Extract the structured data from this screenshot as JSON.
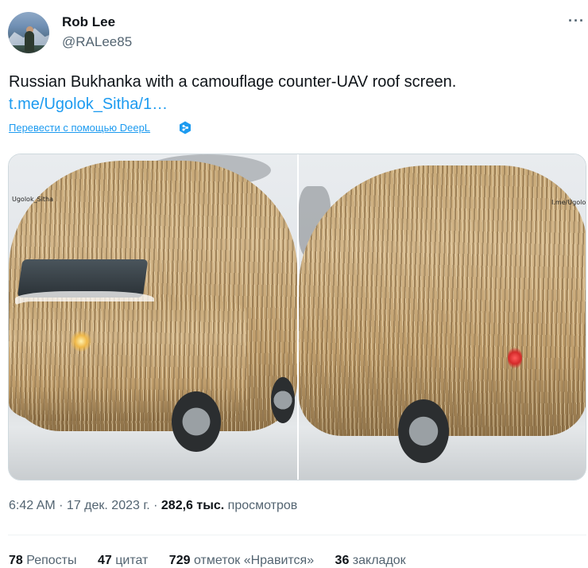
{
  "author": {
    "name": "Rob Lee",
    "handle": "@RALee85"
  },
  "more_label": "···",
  "tweet": {
    "text": "Russian Bukhanka with a camouflage counter-UAV roof screen.",
    "link": "t.me/Ugolok_Sitha/1…",
    "translate_label": "Перевести с помощью DeepL"
  },
  "media": {
    "left_watermark": "Ugolok_Sitha",
    "right_watermark": "I.me/Ugolok"
  },
  "meta": {
    "time_date": "6:42 AM · 17 дек. 2023 г. ·",
    "views_num": "282,6 тыс.",
    "views_label": "просмотров"
  },
  "stats": {
    "retweets_num": "78",
    "retweets_label": "Репосты",
    "quotes_num": "47",
    "quotes_label": "цитат",
    "likes_num": "729",
    "likes_label": "отметок «Нравится»",
    "bookmarks_num": "36",
    "bookmarks_label": "закладок"
  },
  "colors": {
    "link": "#1d9bf0",
    "secondary_text": "#536471",
    "primary_text": "#0f1419"
  }
}
